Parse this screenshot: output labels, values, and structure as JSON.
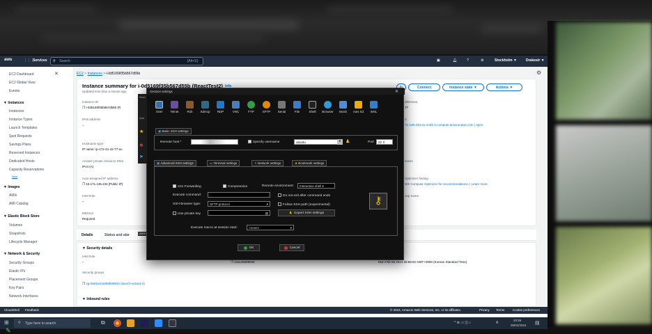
{
  "aws_nav": {
    "services": "Services",
    "search_placeholder": "Search",
    "shortcut": "[Alt+S]",
    "region": "Stockholm ▼",
    "user": "Drakestr ▼"
  },
  "sidebar": {
    "items_top": [
      "EC2 Dashboard",
      "EC2 Global View",
      "Events"
    ],
    "instances_header": "▼ Instances",
    "instances": [
      "Instances",
      "Instance Types",
      "Launch Templates",
      "Spot Requests",
      "Savings Plans",
      "Reserved Instances",
      "Dedicated Hosts",
      "Capacity Reservations"
    ],
    "new_badge": "New",
    "images_header": "▼ Images",
    "images": [
      "AMIs",
      "AMI Catalog"
    ],
    "ebs_header": "▼ Elastic Block Store",
    "ebs": [
      "Volumes",
      "Snapshots",
      "Lifecycle Manager"
    ],
    "net_header": "▼ Network & Security",
    "net": [
      "Security Groups",
      "Elastic IPs",
      "Placement Groups",
      "Key Pairs",
      "Network Interfaces"
    ]
  },
  "breadcrumb": {
    "ec2": "EC2",
    "instances": "Instances",
    "id": "i-0d5169f35b567d55b"
  },
  "summary": {
    "title": "Instance summary for i-0d5169f35b567d55b (ReactTest2)",
    "info": "Info",
    "updated": "Updated less than a minute ago",
    "connect": "Connect",
    "state": "Instance state ▼",
    "actions": "Actions ▼",
    "instance_id_label": "Instance ID",
    "instance_id": "i-0d5169f35b567d55b (R",
    "ipv6_label": "IPv6 address",
    "ipv6": "–",
    "hostname_type_label": "Hostname type",
    "hostname_type": "IP name: ip-172-31-42-77.eu",
    "answer_dns_label": "Answer private resource DNS",
    "answer_dns": "IPv4 (A)",
    "auto_ip_label": "Auto-assigned IP address",
    "auto_ip": "16.171.135.234 [Public IP]",
    "iam_label": "IAM Role",
    "iam": "–",
    "imds_label": "IMDSv2",
    "imds": "Required",
    "right_addresses": "ddresses",
    "right_77": "77",
    "right_s": "S",
    "right_dns": "71-135-234.eu-north-1.compute.amazonaws.com | open",
    "right_sses": "esses",
    "right_optimizer": "Optimizer finding",
    "right_optimizer_link": "WS Compute Optimizer for recommendations. | Learn more",
    "right_group": "oup name",
    "tab_details": "Details",
    "tab_status": "Status and alar",
    "security_header": "▼ Security details",
    "sec_iam_label": "IAM Role",
    "sec_iam": "–",
    "owner_id": "211125689635",
    "launch_time": "Mon Feb 05 2024 20:55:52 GMT+0900 (Korean Standard Time)",
    "sg_label": "Security groups",
    "sg": "sg-0a61edca968b08834 (launch-wizard-2)",
    "inbound_header": "▼ Inbound rules",
    "unreg": "UNREG"
  },
  "cloudshell": {
    "cloudshell": "CloudShell",
    "feedback": "Feedback",
    "copyright": "© 2024, Amazon Web Services, Inc. or its affiliates.",
    "privacy": "Privacy",
    "terms": "Terms",
    "cookie": "Cookie preferences"
  },
  "taskbar": {
    "search": "Type here to search",
    "time": "20:56",
    "date": "05/02/2024",
    "lang": "A"
  },
  "dialog": {
    "title": "Session settings",
    "tools": [
      "SSH",
      "Telnet",
      "Rsh",
      "Xdmcp",
      "RDP",
      "VNC",
      "FTP",
      "SFTP",
      "Serial",
      "File",
      "Shell",
      "Browser",
      "Mosh",
      "Aws S3",
      "WSL"
    ],
    "basic_tab": "Basic SSH settings",
    "remote_host_label": "Remote host *",
    "specify_username": "Specify username",
    "username": "ubuntu",
    "port_label": "Port",
    "port": "22",
    "adv_tab": "Advanced SSH settings",
    "term_tab": "Terminal settings",
    "netw_tab": "Network settings",
    "bookmark_tab": "Bookmark settings",
    "x11": "X11-Forwarding",
    "compression": "Compression",
    "remote_env_label": "Remote environment:",
    "remote_env": "Interactive shell",
    "exec_cmd_label": "Execute command:",
    "no_exit": "Do not exit after command ends",
    "browser_type_label": "SSH-browser type:",
    "browser_type": "SFTP protocol",
    "follow_path": "Follow SSH path (experimental)",
    "use_private_key": "Use private key",
    "expert": "Expert SSH settings",
    "macro_label": "Execute macro at session start:",
    "macro": "<none>",
    "ok": "OK",
    "cancel": "Cancel",
    "left_strip": [
      "Sessi",
      "Quic"
    ]
  },
  "colors": {
    "aws_nav": "#232f3e",
    "aws_link": "#0972d3",
    "dlg_bg": "#111111",
    "ok_green": "#2ea043",
    "cancel_red": "#d13438",
    "key_yellow": "#f2c200"
  }
}
